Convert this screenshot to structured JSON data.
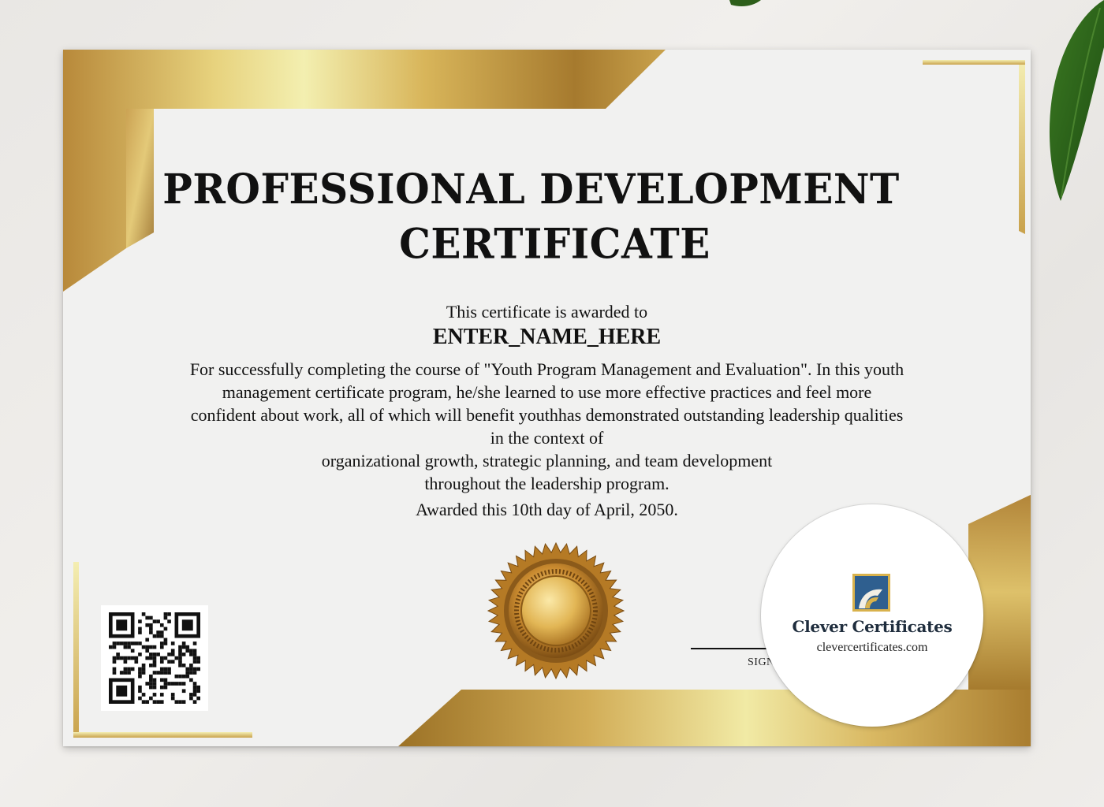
{
  "certificate": {
    "title_line1": "PROFESSIONAL DEVELOPMENT",
    "title_line2": "CERTIFICATE",
    "awarded_to_label": "This certificate is awarded to",
    "recipient_name": "ENTER_NAME_HERE",
    "body_lines": [
      "For successfully completing the course of \"Youth Program Management and Evaluation\". In this youth",
      "management certificate program, he/she learned to use more effective practices and feel more",
      "confident about work, all of which will benefit youthhas demonstrated outstanding leadership qualities",
      "in the context of",
      "organizational growth, strategic planning, and team development",
      "throughout the leadership program."
    ],
    "date_line": "Awarded this 10th day of April, 2050.",
    "signature_label": "SIGNATURE"
  },
  "watermark": {
    "brand": "Clever Certificates",
    "url": "clevercertificates.com"
  },
  "colors": {
    "gold_light": "#f2eca8",
    "gold_mid": "#d7b15d",
    "gold_dark": "#9c7226",
    "paper": "#f1f1f0",
    "text": "#111111",
    "brand_blue": "#2f5f8f"
  },
  "icons": {
    "seal": "gold-seal-icon",
    "qr": "qr-code-icon",
    "logo": "clever-certificates-logo",
    "leaf": "leaf-icon"
  }
}
